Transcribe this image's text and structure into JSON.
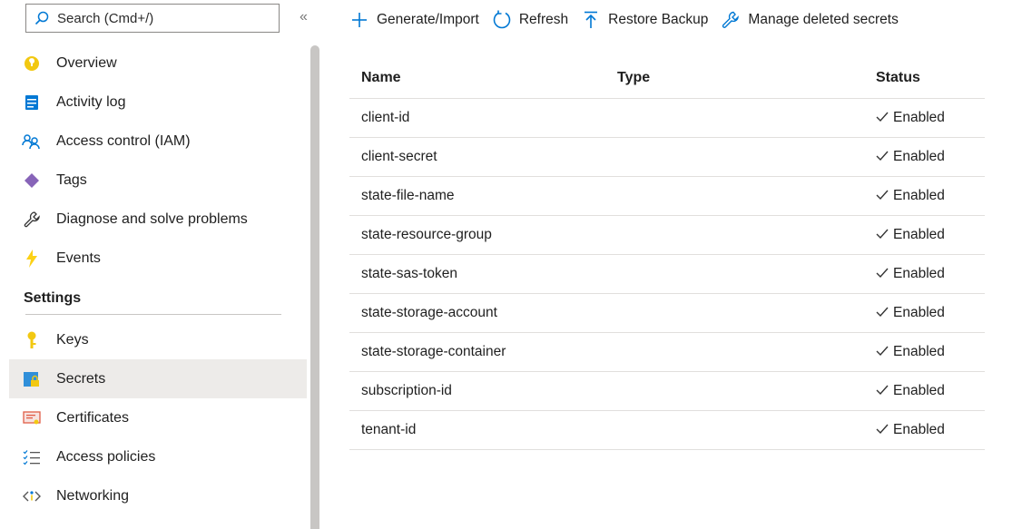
{
  "sidebar": {
    "search_placeholder": "Search (Cmd+/)",
    "collapse_label": "«",
    "items": [
      {
        "label": "Overview",
        "icon": "overview-icon"
      },
      {
        "label": "Activity log",
        "icon": "activity-log-icon"
      },
      {
        "label": "Access control (IAM)",
        "icon": "iam-icon"
      },
      {
        "label": "Tags",
        "icon": "tag-icon"
      },
      {
        "label": "Diagnose and solve problems",
        "icon": "wrench-icon"
      },
      {
        "label": "Events",
        "icon": "lightning-icon"
      }
    ],
    "settings_title": "Settings",
    "settings_items": [
      {
        "label": "Keys",
        "icon": "key-icon"
      },
      {
        "label": "Secrets",
        "icon": "secrets-icon",
        "selected": true
      },
      {
        "label": "Certificates",
        "icon": "certificate-icon"
      },
      {
        "label": "Access policies",
        "icon": "access-policies-icon"
      },
      {
        "label": "Networking",
        "icon": "networking-icon"
      }
    ]
  },
  "toolbar": {
    "generate_label": "Generate/Import",
    "refresh_label": "Refresh",
    "restore_label": "Restore Backup",
    "manage_deleted_label": "Manage deleted secrets"
  },
  "table": {
    "columns": [
      "Name",
      "Type",
      "Status"
    ],
    "rows": [
      {
        "name": "client-id",
        "type": "",
        "status": "Enabled"
      },
      {
        "name": "client-secret",
        "type": "",
        "status": "Enabled"
      },
      {
        "name": "state-file-name",
        "type": "",
        "status": "Enabled"
      },
      {
        "name": "state-resource-group",
        "type": "",
        "status": "Enabled"
      },
      {
        "name": "state-sas-token",
        "type": "",
        "status": "Enabled"
      },
      {
        "name": "state-storage-account",
        "type": "",
        "status": "Enabled"
      },
      {
        "name": "state-storage-container",
        "type": "",
        "status": "Enabled"
      },
      {
        "name": "subscription-id",
        "type": "",
        "status": "Enabled"
      },
      {
        "name": "tenant-id",
        "type": "",
        "status": "Enabled"
      }
    ]
  },
  "colors": {
    "accent": "#0078d4",
    "selected_bg": "#edebe9",
    "key_yellow": "#f2c811",
    "tag_purple": "#8764b8",
    "events_yellow": "#fcd116"
  }
}
